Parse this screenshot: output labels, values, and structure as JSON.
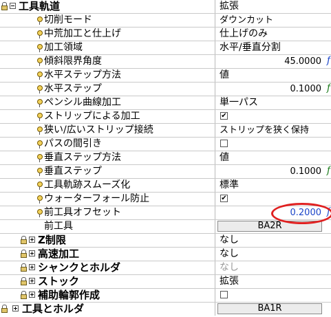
{
  "section_toolpath": {
    "label": "工具軌道",
    "value": "拡張"
  },
  "toolpath_items": [
    {
      "label": "切削モード",
      "value": "ダウンカット"
    },
    {
      "label": "中荒加工と仕上げ",
      "value": "仕上げのみ"
    },
    {
      "label": "加工領域",
      "value": "水平/垂直分割"
    },
    {
      "label": "傾斜限界角度",
      "value": "45.0000"
    },
    {
      "label": "水平ステップ方法",
      "value": "値"
    },
    {
      "label": "水平ステップ",
      "value": "0.1000"
    },
    {
      "label": "ペンシル曲線加工",
      "value": "単一パス"
    },
    {
      "label": "ストリップによる加工",
      "checked": true
    },
    {
      "label": "狭い/広いストリップ接続",
      "value": "ストリップを狭く保持"
    },
    {
      "label": "パスの間引き",
      "checked": false
    },
    {
      "label": "垂直ステップ方法",
      "value": "値"
    },
    {
      "label": "垂直ステップ",
      "value": "0.1000"
    },
    {
      "label": "工具軌跡スムーズ化",
      "value": "標準"
    },
    {
      "label": "ウォーターフォール防止",
      "checked": true
    },
    {
      "label": "前工具オフセット",
      "value": "0.2000"
    },
    {
      "label": "前工具",
      "value": "BA2R"
    }
  ],
  "groups": [
    {
      "label": "Z制限",
      "value": "なし"
    },
    {
      "label": "高速加工",
      "value": "なし"
    },
    {
      "label": "シャンクとホルダ",
      "value": "なし"
    },
    {
      "label": "ストック",
      "value": "拡張"
    },
    {
      "label": "補助輪郭作成",
      "checked": false
    }
  ],
  "section_tool_holder": {
    "label": "工具とホルダ",
    "value": "BA1R"
  },
  "icons": {
    "formula": "f"
  },
  "colors": {
    "formula_green": "#1a7a1a",
    "formula_blue": "#1b44c8",
    "highlight": "#e02020"
  }
}
